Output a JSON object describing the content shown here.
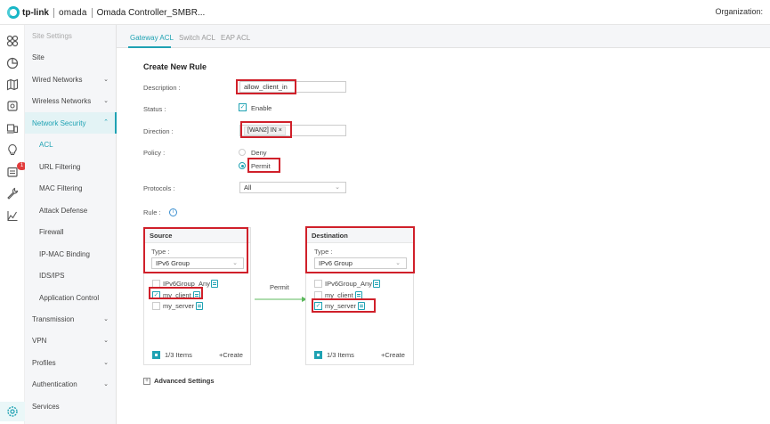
{
  "header": {
    "brand_tp": "tp-link",
    "brand_omada": "omada",
    "title": "Omada Controller_SMBR...",
    "organization_label": "Organization:"
  },
  "rail": {
    "icons": [
      "dashboard-icon",
      "statistics-icon",
      "map-icon",
      "devices-icon",
      "clients-icon",
      "insight-icon",
      "log-icon",
      "tools-icon",
      "report-icon",
      "settings-icon"
    ],
    "log_badge": "1"
  },
  "menu": {
    "header": "Site Settings",
    "items": [
      {
        "label": "Site"
      },
      {
        "label": "Wired Networks"
      },
      {
        "label": "Wireless Networks"
      },
      {
        "label": "Network Security"
      },
      {
        "label": "ACL"
      },
      {
        "label": "URL Filtering"
      },
      {
        "label": "MAC Filtering"
      },
      {
        "label": "Attack Defense"
      },
      {
        "label": "Firewall"
      },
      {
        "label": "IP-MAC Binding"
      },
      {
        "label": "IDS/IPS"
      },
      {
        "label": "Application Control"
      },
      {
        "label": "Transmission"
      },
      {
        "label": "VPN"
      },
      {
        "label": "Profiles"
      },
      {
        "label": "Authentication"
      },
      {
        "label": "Services"
      }
    ]
  },
  "tabs": [
    {
      "label": "Gateway ACL"
    },
    {
      "label": "Switch ACL"
    },
    {
      "label": "EAP ACL"
    }
  ],
  "form": {
    "title": "Create New Rule",
    "description_label": "Description :",
    "description_value": "allow_client_in",
    "status_label": "Status :",
    "status_enable": "Enable",
    "direction_label": "Direction :",
    "direction_tag": "[WAN2] IN",
    "policy_label": "Policy :",
    "policy_deny": "Deny",
    "policy_permit": "Permit",
    "protocols_label": "Protocols :",
    "protocols_value": "All",
    "rule_label": "Rule :",
    "advanced_label": "Advanced Settings"
  },
  "source": {
    "title": "Source",
    "type_label": "Type :",
    "type_value": "IPv6 Group",
    "items": [
      {
        "label": "IPv6Group_Any",
        "checked": false
      },
      {
        "label": "my_client",
        "checked": true
      },
      {
        "label": "my_server",
        "checked": false
      }
    ],
    "count": "1/3 Items",
    "create": "Create"
  },
  "arrow_label": "Permit",
  "destination": {
    "title": "Destination",
    "type_label": "Type :",
    "type_value": "IPv6 Group",
    "items": [
      {
        "label": "IPv6Group_Any",
        "checked": false
      },
      {
        "label": "my_client",
        "checked": false
      },
      {
        "label": "my_server",
        "checked": true
      }
    ],
    "count": "1/3 Items",
    "create": "Create"
  },
  "colors": {
    "accent": "#1fa2b3",
    "highlight_box": "#d0202a",
    "menu_bg": "#f5f6f8"
  }
}
